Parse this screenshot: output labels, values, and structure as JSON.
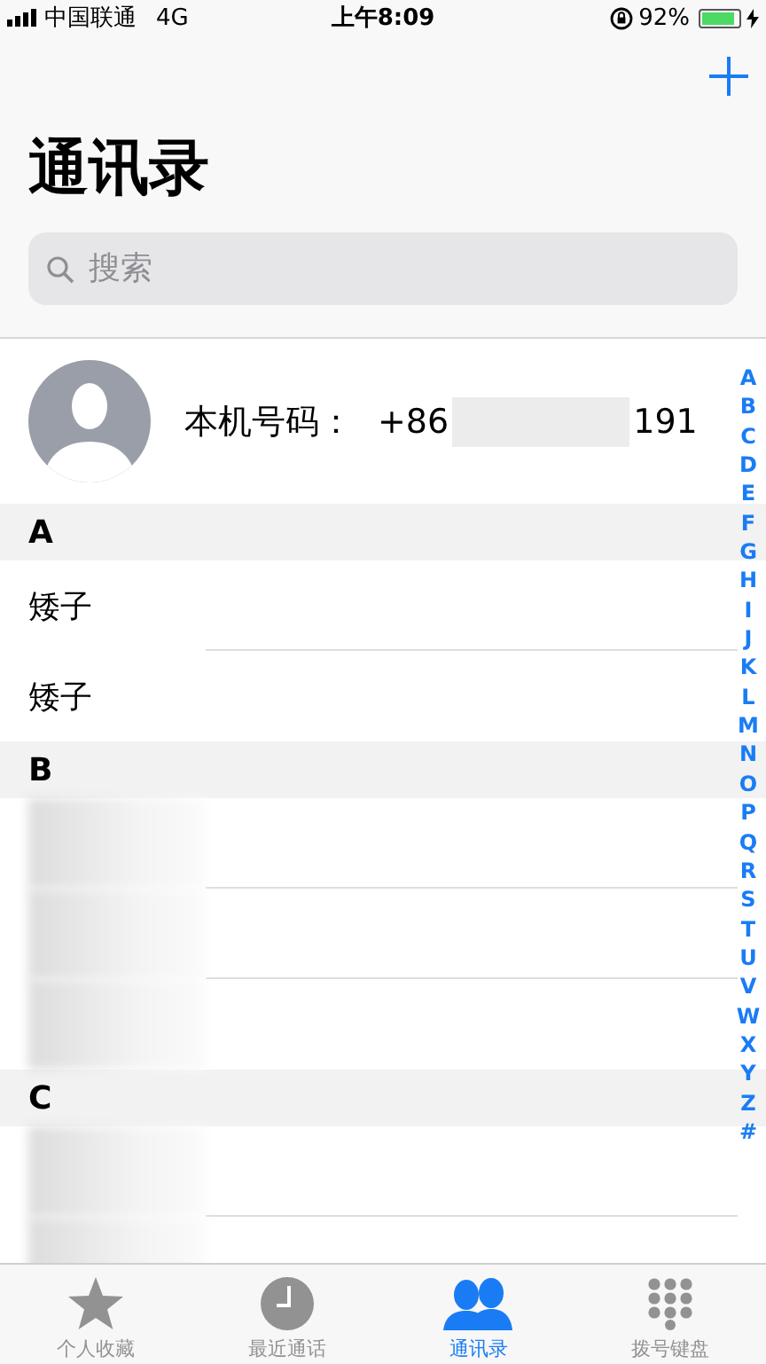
{
  "status_bar": {
    "carrier": "中国联通",
    "network": "4G",
    "time": "上午8:09",
    "battery": "92%"
  },
  "nav": {
    "title": "通讯录"
  },
  "search": {
    "placeholder": "搜索"
  },
  "my_card": {
    "label": "本机号码：",
    "phone_prefix": "+86",
    "phone_suffix": "191"
  },
  "sections": [
    {
      "letter": "A",
      "contacts": [
        {
          "kind": "name",
          "name": "矮子"
        },
        {
          "kind": "name",
          "name": "矮子"
        }
      ]
    },
    {
      "letter": "B",
      "contacts": [
        {
          "kind": "redacted"
        },
        {
          "kind": "redacted"
        },
        {
          "kind": "redacted"
        }
      ]
    },
    {
      "letter": "C",
      "contacts": [
        {
          "kind": "redacted"
        },
        {
          "kind": "redacted"
        }
      ]
    }
  ],
  "index": [
    "A",
    "B",
    "C",
    "D",
    "E",
    "F",
    "G",
    "H",
    "I",
    "J",
    "K",
    "L",
    "M",
    "N",
    "O",
    "P",
    "Q",
    "R",
    "S",
    "T",
    "U",
    "V",
    "W",
    "X",
    "Y",
    "Z",
    "#"
  ],
  "tabs": [
    {
      "label": "个人收藏",
      "selected": false
    },
    {
      "label": "最近通话",
      "selected": false
    },
    {
      "label": "通讯录",
      "selected": true
    },
    {
      "label": "拨号键盘",
      "selected": false
    }
  ]
}
